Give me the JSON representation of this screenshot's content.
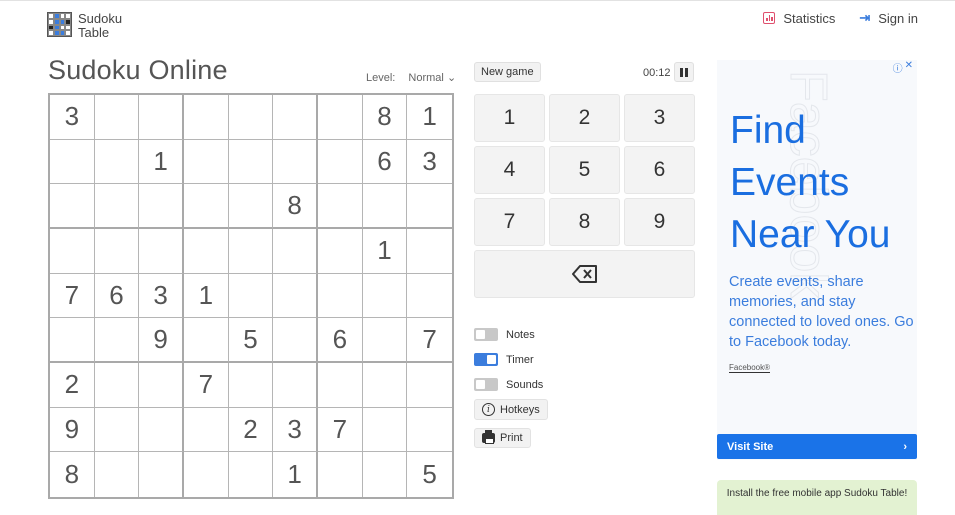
{
  "header": {
    "logo_line1": "Sudoku",
    "logo_line2": "Table",
    "nav": [
      {
        "label": "Statistics",
        "icon": "bar-chart-icon",
        "color": "#e0506e"
      },
      {
        "label": "Sign in",
        "icon": "sign-in-icon",
        "color": "#3b7ddd"
      }
    ]
  },
  "game": {
    "title": "Sudoku Online",
    "level_label": "Level:",
    "level_value": "Normal",
    "new_game_label": "New game",
    "timer": "00:12",
    "board": [
      [
        "3",
        "",
        "",
        "",
        "",
        "",
        "",
        "8",
        "1"
      ],
      [
        "",
        "",
        "1",
        "",
        "",
        "",
        "",
        "6",
        "3"
      ],
      [
        "",
        "",
        "",
        "",
        "",
        "8",
        "",
        "",
        ""
      ],
      [
        "",
        "",
        "",
        "",
        "",
        "",
        "",
        "1",
        ""
      ],
      [
        "7",
        "6",
        "3",
        "1",
        "",
        "",
        "",
        "",
        ""
      ],
      [
        "",
        "",
        "9",
        "",
        "5",
        "",
        "6",
        "",
        "7"
      ],
      [
        "2",
        "",
        "",
        "7",
        "",
        "",
        "",
        "",
        ""
      ],
      [
        "9",
        "",
        "",
        "",
        "2",
        "3",
        "7",
        "",
        ""
      ],
      [
        "8",
        "",
        "",
        "",
        "",
        "1",
        "",
        "",
        "5"
      ]
    ],
    "keypad": [
      "1",
      "2",
      "3",
      "4",
      "5",
      "6",
      "7",
      "8",
      "9"
    ],
    "erase_icon": "backspace-icon",
    "options": [
      {
        "label": "Notes",
        "on": false
      },
      {
        "label": "Timer",
        "on": true
      },
      {
        "label": "Sounds",
        "on": false
      }
    ],
    "hotkeys_label": "Hotkeys",
    "print_label": "Print"
  },
  "ad": {
    "watermark": "Facebook",
    "headline": [
      "Find",
      "Events",
      "Near You"
    ],
    "body": "Create events, share memories, and stay connected to loved ones. Go to Facebook today.",
    "brand": "Facebook®",
    "cta": "Visit Site",
    "accent": "#1a73e8"
  },
  "promo": {
    "text": "Install the free mobile app Sudoku Table!"
  }
}
